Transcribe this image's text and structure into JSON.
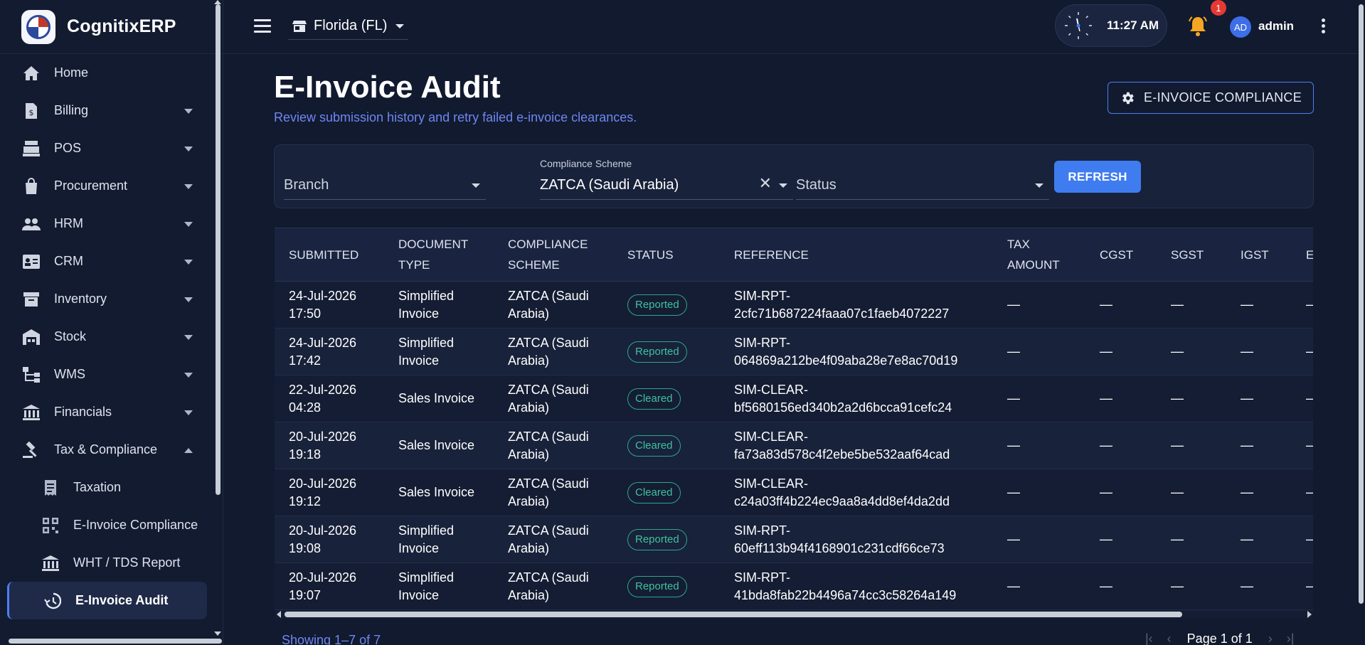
{
  "app": {
    "name": "CognitixERP"
  },
  "sidebar": {
    "items": [
      {
        "label": "Home",
        "icon": "home-icon",
        "expandable": false
      },
      {
        "label": "Billing",
        "icon": "billing-icon",
        "expandable": true
      },
      {
        "label": "POS",
        "icon": "pos-icon",
        "expandable": true
      },
      {
        "label": "Procurement",
        "icon": "shopping-bag-icon",
        "expandable": true
      },
      {
        "label": "HRM",
        "icon": "people-icon",
        "expandable": true
      },
      {
        "label": "CRM",
        "icon": "contact-card-icon",
        "expandable": true
      },
      {
        "label": "Inventory",
        "icon": "archive-icon",
        "expandable": true
      },
      {
        "label": "Stock",
        "icon": "warehouse-icon",
        "expandable": true
      },
      {
        "label": "WMS",
        "icon": "hierarchy-icon",
        "expandable": true
      },
      {
        "label": "Financials",
        "icon": "bank-icon",
        "expandable": true
      },
      {
        "label": "Tax & Compliance",
        "icon": "gavel-icon",
        "expandable": true,
        "expanded": true
      }
    ],
    "sub_items": [
      {
        "label": "Taxation",
        "icon": "receipt-icon"
      },
      {
        "label": "E-Invoice Compliance",
        "icon": "qr-code-icon"
      },
      {
        "label": "WHT / TDS Report",
        "icon": "bank-icon"
      },
      {
        "label": "E-Invoice Audit",
        "icon": "history-icon",
        "active": true
      }
    ]
  },
  "topbar": {
    "store": "Florida (FL)",
    "time": "11:27 AM",
    "notification_count": "1",
    "avatar_initials": "AD",
    "user": "admin"
  },
  "page": {
    "title": "E-Invoice Audit",
    "subtitle": "Review submission history and retry failed e-invoice clearances.",
    "compliance_button": "E-INVOICE COMPLIANCE"
  },
  "filters": {
    "branch_placeholder": "Branch",
    "scheme_label": "Compliance Scheme",
    "scheme_value": "ZATCA (Saudi Arabia)",
    "status_placeholder": "Status",
    "refresh": "REFRESH"
  },
  "table": {
    "headers": [
      "SUBMITTED",
      "DOCUMENT TYPE",
      "COMPLIANCE SCHEME",
      "STATUS",
      "REFERENCE",
      "TAX AMOUNT",
      "CGST",
      "SGST",
      "IGST",
      "E"
    ],
    "rows": [
      {
        "submitted": "24-Jul-2026 17:50",
        "doc_type": "Simplified Invoice",
        "scheme": "ZATCA (Saudi Arabia)",
        "status": "Reported",
        "reference": "SIM-RPT-2cfc71b687224faaa07c1faeb4072227",
        "tax": "—",
        "cgst": "—",
        "sgst": "—",
        "igst": "—",
        "extra": "—"
      },
      {
        "submitted": "24-Jul-2026 17:42",
        "doc_type": "Simplified Invoice",
        "scheme": "ZATCA (Saudi Arabia)",
        "status": "Reported",
        "reference": "SIM-RPT-064869a212be4f09aba28e7e8ac70d19",
        "tax": "—",
        "cgst": "—",
        "sgst": "—",
        "igst": "—",
        "extra": "—"
      },
      {
        "submitted": "22-Jul-2026 04:28",
        "doc_type": "Sales Invoice",
        "scheme": "ZATCA (Saudi Arabia)",
        "status": "Cleared",
        "reference": "SIM-CLEAR-bf5680156ed340b2a2d6bcca91cefc24",
        "tax": "—",
        "cgst": "—",
        "sgst": "—",
        "igst": "—",
        "extra": "—"
      },
      {
        "submitted": "20-Jul-2026 19:18",
        "doc_type": "Sales Invoice",
        "scheme": "ZATCA (Saudi Arabia)",
        "status": "Cleared",
        "reference": "SIM-CLEAR-fa73a83d578c4f2ebe5be532aaf64cad",
        "tax": "—",
        "cgst": "—",
        "sgst": "—",
        "igst": "—",
        "extra": "—"
      },
      {
        "submitted": "20-Jul-2026 19:12",
        "doc_type": "Sales Invoice",
        "scheme": "ZATCA (Saudi Arabia)",
        "status": "Cleared",
        "reference": "SIM-CLEAR-c24a03ff4b224ec9aa8a4dd8ef4da2dd",
        "tax": "—",
        "cgst": "—",
        "sgst": "—",
        "igst": "—",
        "extra": "—"
      },
      {
        "submitted": "20-Jul-2026 19:08",
        "doc_type": "Simplified Invoice",
        "scheme": "ZATCA (Saudi Arabia)",
        "status": "Reported",
        "reference": "SIM-RPT-60eff113b94f4168901c231cdf66ce73",
        "tax": "—",
        "cgst": "—",
        "sgst": "—",
        "igst": "—",
        "extra": "—"
      },
      {
        "submitted": "20-Jul-2026 19:07",
        "doc_type": "Simplified Invoice",
        "scheme": "ZATCA (Saudi Arabia)",
        "status": "Reported",
        "reference": "SIM-RPT-41bda8fab22b4496a74cc3c58264a149",
        "tax": "—",
        "cgst": "—",
        "sgst": "—",
        "igst": "—",
        "extra": "—"
      }
    ]
  },
  "footer": {
    "showing": "Showing 1–7 of 7",
    "page": "Page 1 of 1"
  },
  "colors": {
    "accent": "#3f7cf0",
    "subtitle": "#6f86f2",
    "status_chip": "#3fc1a0",
    "badge": "#e53935"
  }
}
